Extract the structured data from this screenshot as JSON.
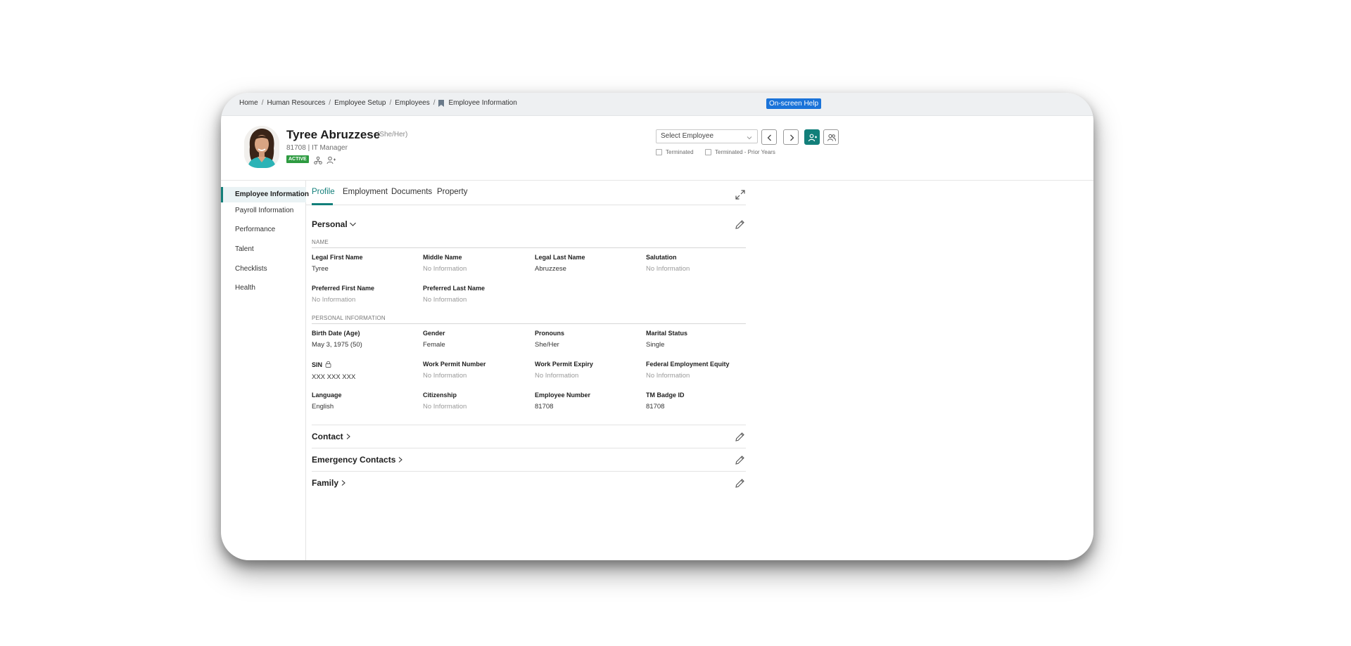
{
  "breadcrumb": [
    "Home",
    "Human Resources",
    "Employee Setup",
    "Employees",
    "Employee Information"
  ],
  "help_label": "On-screen Help",
  "employee": {
    "name": "Tyree Abruzzese",
    "pronouns": "(She/Her)",
    "subtitle": "81708 | IT Manager",
    "status": "ACTIVE"
  },
  "selector": {
    "placeholder": "Select Employee",
    "terminated": "Terminated",
    "terminated_prior": "Terminated - Prior Years"
  },
  "sidebar": {
    "items": [
      "Employee Information",
      "Payroll Information",
      "Performance",
      "Talent",
      "Checklists",
      "Health"
    ]
  },
  "tabs": [
    "Profile",
    "Employment",
    "Documents",
    "Property"
  ],
  "personal": {
    "title": "Personal",
    "name_heading": "NAME",
    "info_heading": "PERSONAL INFORMATION",
    "fields": [
      {
        "label": "Legal First Name",
        "value": "Tyree"
      },
      {
        "label": "Middle Name",
        "value": "No Information"
      },
      {
        "label": "Legal Last Name",
        "value": "Abruzzese"
      },
      {
        "label": "Salutation",
        "value": "No Information"
      },
      {
        "label": "Preferred First Name",
        "value": "No Information"
      },
      {
        "label": "Preferred Last Name",
        "value": "No Information"
      },
      {
        "label": "Birth Date (Age)",
        "value": "May 3, 1975 (50)"
      },
      {
        "label": "Gender",
        "value": "Female"
      },
      {
        "label": "Pronouns",
        "value": "She/Her"
      },
      {
        "label": "Marital Status",
        "value": "Single"
      },
      {
        "label": "SIN",
        "value": "XXX XXX XXX"
      },
      {
        "label": "Work Permit Number",
        "value": "No Information"
      },
      {
        "label": "Work Permit Expiry",
        "value": "No Information"
      },
      {
        "label": "Federal Employment Equity",
        "value": "No Information"
      },
      {
        "label": "Language",
        "value": "English"
      },
      {
        "label": "Citizenship",
        "value": "No Information"
      },
      {
        "label": "Employee Number",
        "value": "81708"
      },
      {
        "label": "TM Badge ID",
        "value": "81708"
      }
    ]
  },
  "sections": [
    "Contact",
    "Emergency Contacts",
    "Family"
  ],
  "colors": {
    "accent": "#127f7a",
    "active_badge": "#2e9b41",
    "help_badge": "#1a73d9"
  }
}
